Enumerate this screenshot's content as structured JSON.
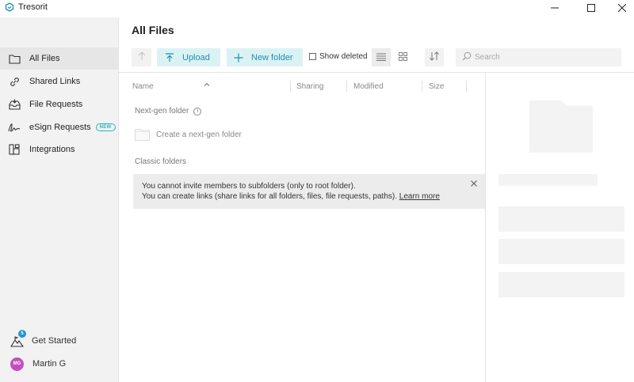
{
  "app": {
    "title": "Tresorit",
    "logo_icon": "tresorit-logo-icon"
  },
  "window_controls": [
    "minimize-icon",
    "maximize-icon",
    "close-icon"
  ],
  "sidebar": {
    "items": [
      {
        "label": "All Files",
        "icon": "folder-icon",
        "active": true
      },
      {
        "label": "Shared Links",
        "icon": "link-icon"
      },
      {
        "label": "File Requests",
        "icon": "inbox-icon"
      },
      {
        "label": "eSign Requests",
        "icon": "signature-icon",
        "badge": "NEW"
      },
      {
        "label": "Integrations",
        "icon": "integrations-icon"
      }
    ],
    "get_started": {
      "label": "Get Started",
      "badge_count": "5"
    },
    "user": {
      "initials": "MG",
      "name": "Martin G",
      "avatar_color": "#c24fbf"
    }
  },
  "main": {
    "title": "All Files",
    "toolbar": {
      "upload_label": "Upload",
      "new_folder_label": "New folder",
      "show_deleted_label": "Show deleted",
      "show_deleted_checked": false,
      "search_placeholder": "Search"
    },
    "columns": [
      "Name",
      "Sharing",
      "Modified",
      "Size"
    ],
    "next_gen_section": "Next-gen folder",
    "create_next_gen": "Create a next-gen folder",
    "classic_section": "Classic folders",
    "notice": {
      "line1": "You cannot invite members to subfolders (only to root folder).",
      "line2": "You can create links (share links for all folders, files, file requests, paths).",
      "link": "Learn more"
    }
  },
  "colors": {
    "accent": "#1e8fa8",
    "accent_bg": "#dbf2f5",
    "badge": "#2bb3c0",
    "sidebar_bg": "#f2f2f2"
  }
}
